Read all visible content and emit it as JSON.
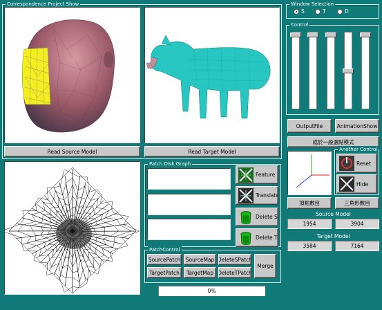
{
  "correspondence_group": {
    "label": "Correspondence Project Show",
    "read_source_label": "Read Source Model",
    "read_target_label": "Read Target Model"
  },
  "patch_disk_graph": {
    "label": "Patch Disk Graph",
    "feature_label": "Feature",
    "translate_label": "Translate",
    "delete_sp_label": "Delete SP",
    "delete_tp_label": "Delete TP"
  },
  "patch_control": {
    "label": "PatchControl",
    "source_patch_label": "SourcePatch",
    "source_map_label": "SourceMap",
    "delete_s_patch_label": "DeleteSPatch",
    "target_patch_label": "TargetPatch",
    "target_map_label": "TargetMap",
    "delete_t_patch_label": "DeleteTPatch",
    "merge_label": "Merge",
    "progress_text": "0%",
    "progress_value": 0
  },
  "window_selection": {
    "label": "Window Selection",
    "options": [
      {
        "label": "S",
        "selected": true
      },
      {
        "label": "T",
        "selected": false
      },
      {
        "label": "D",
        "selected": false
      }
    ]
  },
  "control": {
    "label": "Control",
    "sliders": [
      0.0,
      0.0,
      0.0,
      0.5,
      0.0
    ]
  },
  "buttons": {
    "output_file_label": "OutputFile",
    "animation_show_label": "AnimationShow",
    "mode_label": "成於一般選點模式"
  },
  "another_control": {
    "label": "Another Control",
    "reset_label": "Reset",
    "hide_label": "Hide"
  },
  "counts": {
    "vertex_count_label": "頂點數目",
    "triangle_count_label": "三角形數目",
    "source_model_label": "Source Model",
    "source_vertices": "1954",
    "source_triangles": "3904",
    "target_model_label": "Target Model",
    "target_vertices": "3584",
    "target_triangles": "7164"
  },
  "colors": {
    "background": "#0f7a78",
    "mesh_yellow": "#f2ee22",
    "mesh_flesh": "#b46a78",
    "pig_cyan": "#27c6c0"
  }
}
